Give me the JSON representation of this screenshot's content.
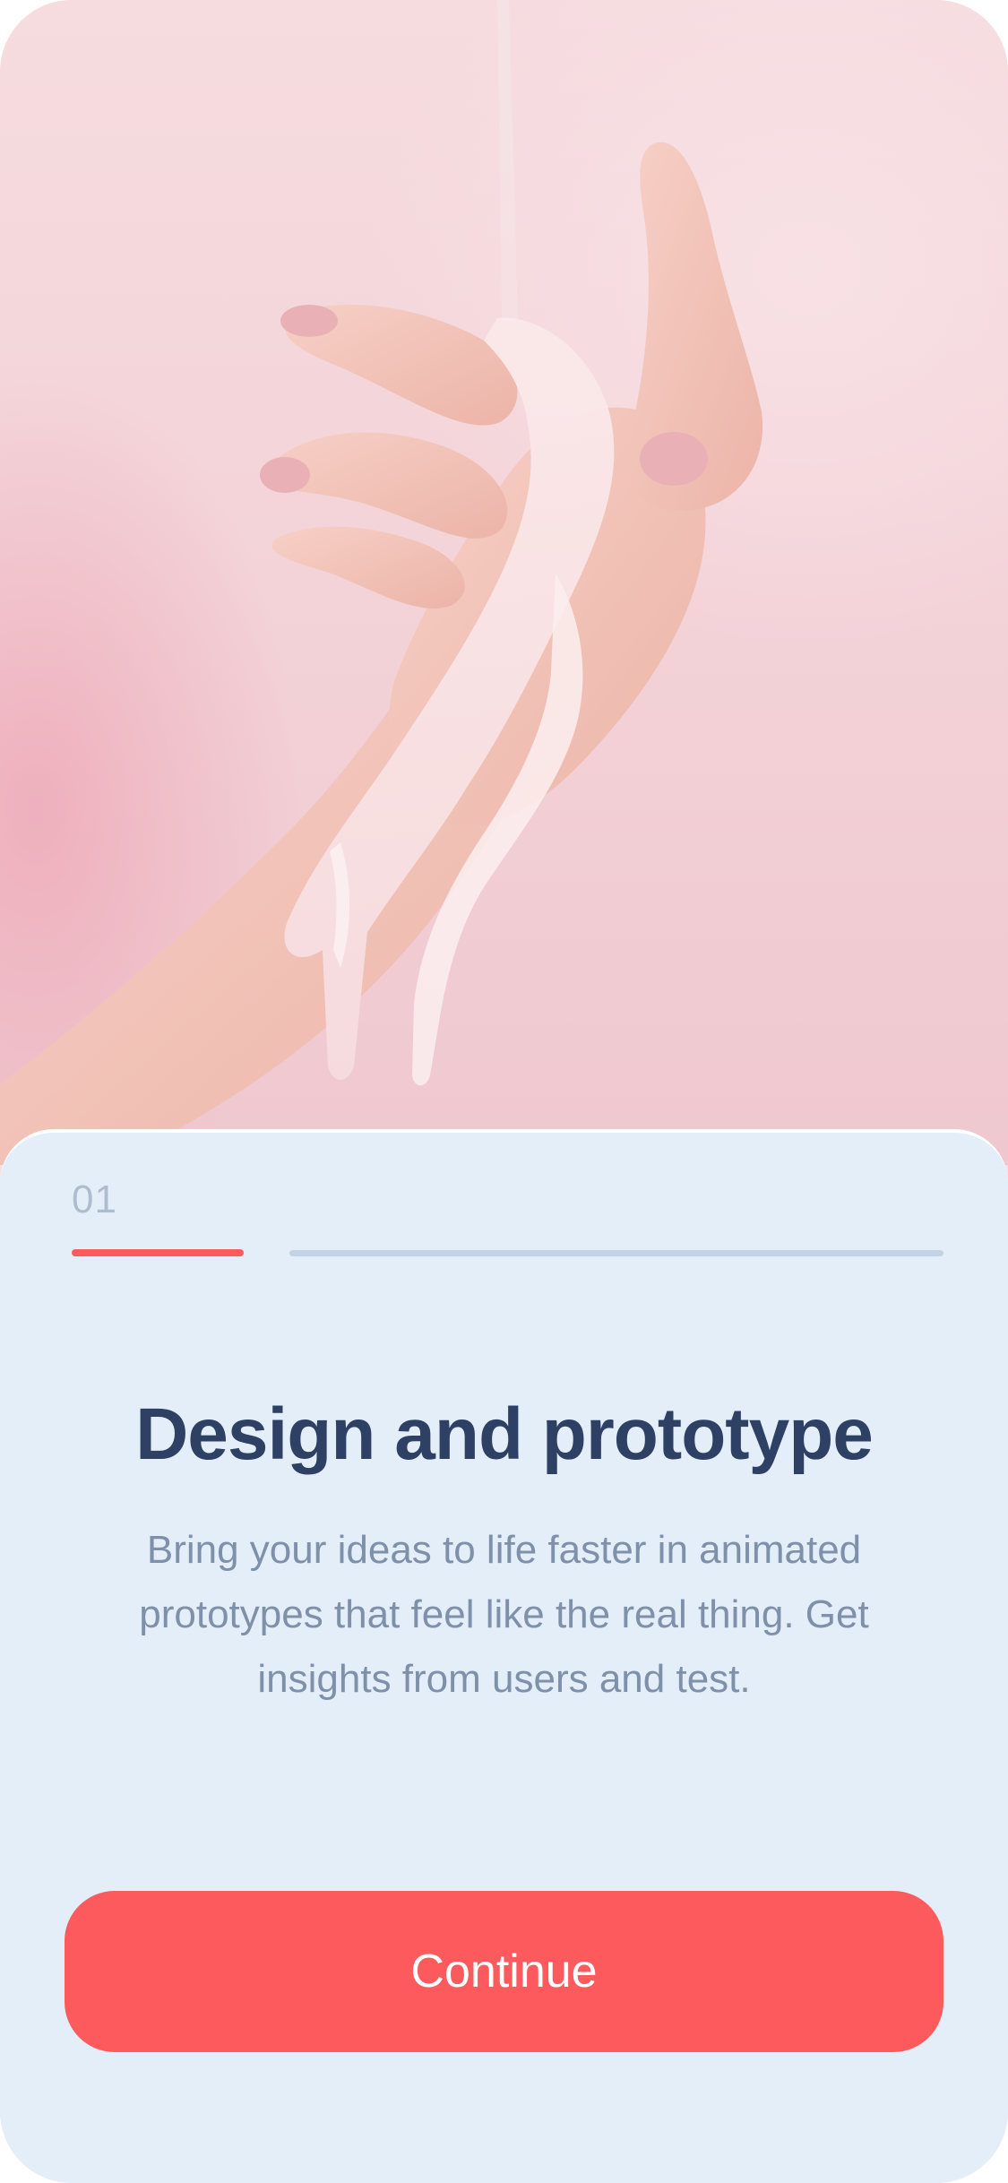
{
  "hero": {
    "image_icon": "hand-with-pouring-cream-illustration"
  },
  "onboarding": {
    "step_number": "01",
    "progress_fraction": 0.2,
    "title": "Design and prototype",
    "description": "Bring your ideas to life faster in animated prototypes that feel like the real thing. Get insights from users and test.",
    "cta_label": "Continue"
  },
  "colors": {
    "accent": "#fd5a5e",
    "card_background": "#e3eef9",
    "title": "#2e4164",
    "body_text": "#7e90aa",
    "step_number": "#aebcd0",
    "progress_track": "#c4d3e4"
  }
}
